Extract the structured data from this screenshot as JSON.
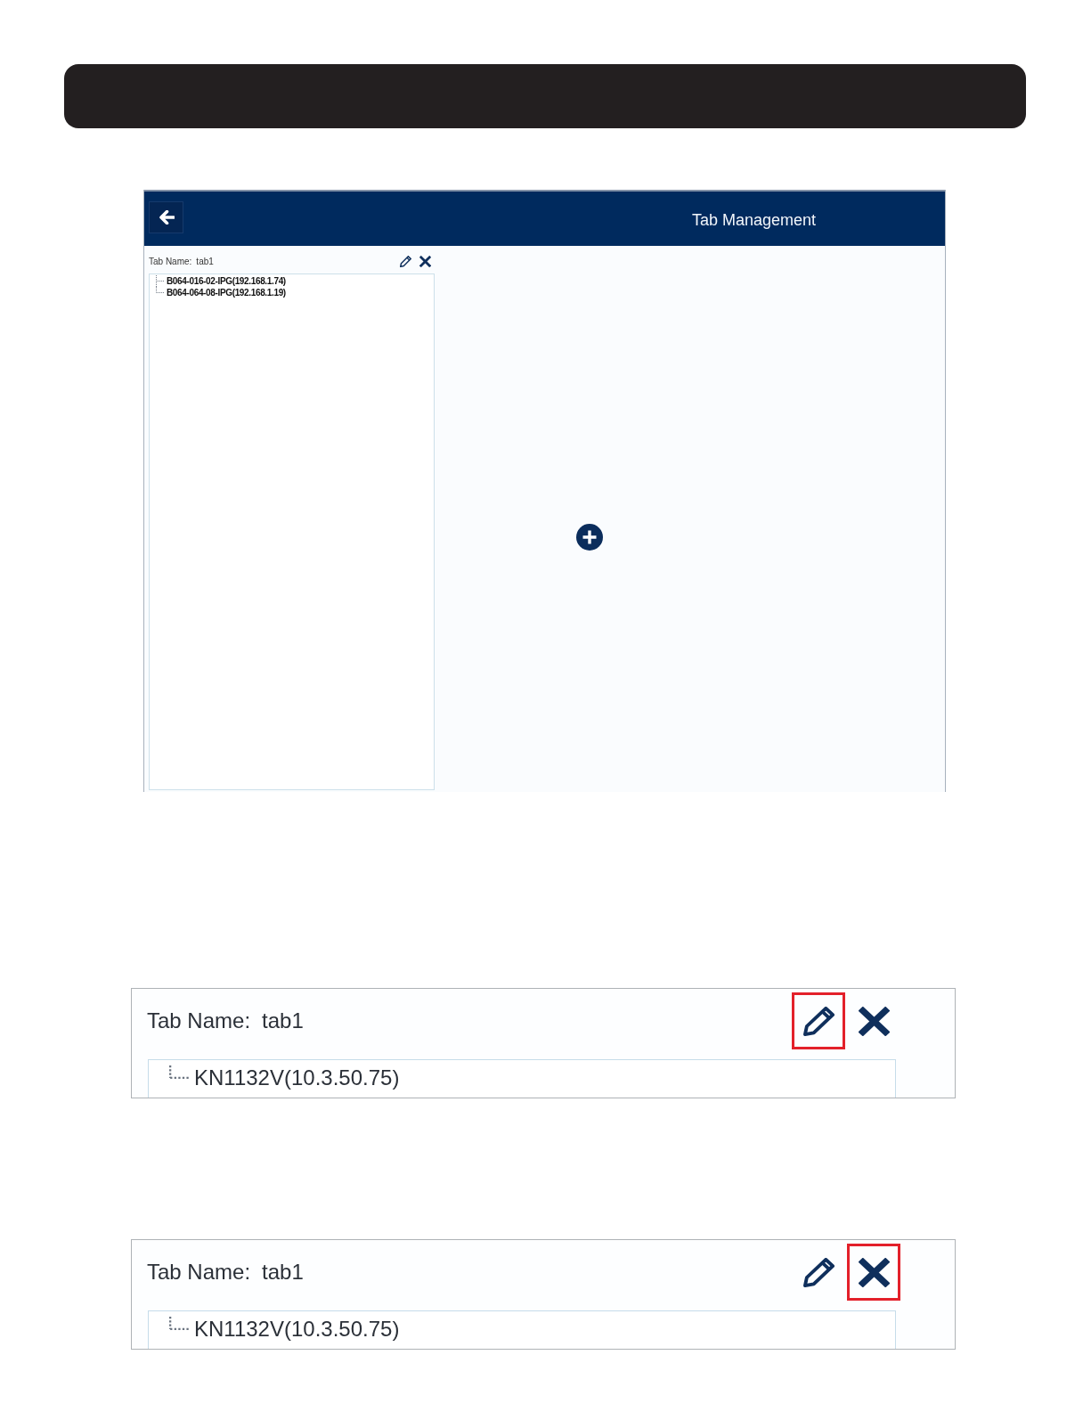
{
  "app_window": {
    "title": "Tab Management",
    "tab_name_label": "Tab Name:",
    "tab_name": "tab1",
    "buttons": [
      {
        "kind": "edit"
      },
      {
        "kind": "delete"
      }
    ],
    "tree": [
      {
        "label": "B064-016-02-IPG(192.168.1.74)"
      },
      {
        "label": "B064-064-08-IPG(192.168.1.19)"
      }
    ]
  },
  "closeups": [
    {
      "tab_name_label": "Tab Name:",
      "tab_name": "tab1",
      "buttons": [
        {
          "kind": "edit",
          "highlighted": true
        },
        {
          "kind": "delete",
          "highlighted": false
        }
      ],
      "tree": [
        {
          "label": "KN1132V(10.3.50.75)"
        }
      ]
    },
    {
      "tab_name_label": "Tab Name:",
      "tab_name": "tab1",
      "buttons": [
        {
          "kind": "edit",
          "highlighted": false
        },
        {
          "kind": "delete",
          "highlighted": true
        }
      ],
      "tree": [
        {
          "label": "KN1132V(10.3.50.75)"
        }
      ]
    }
  ]
}
